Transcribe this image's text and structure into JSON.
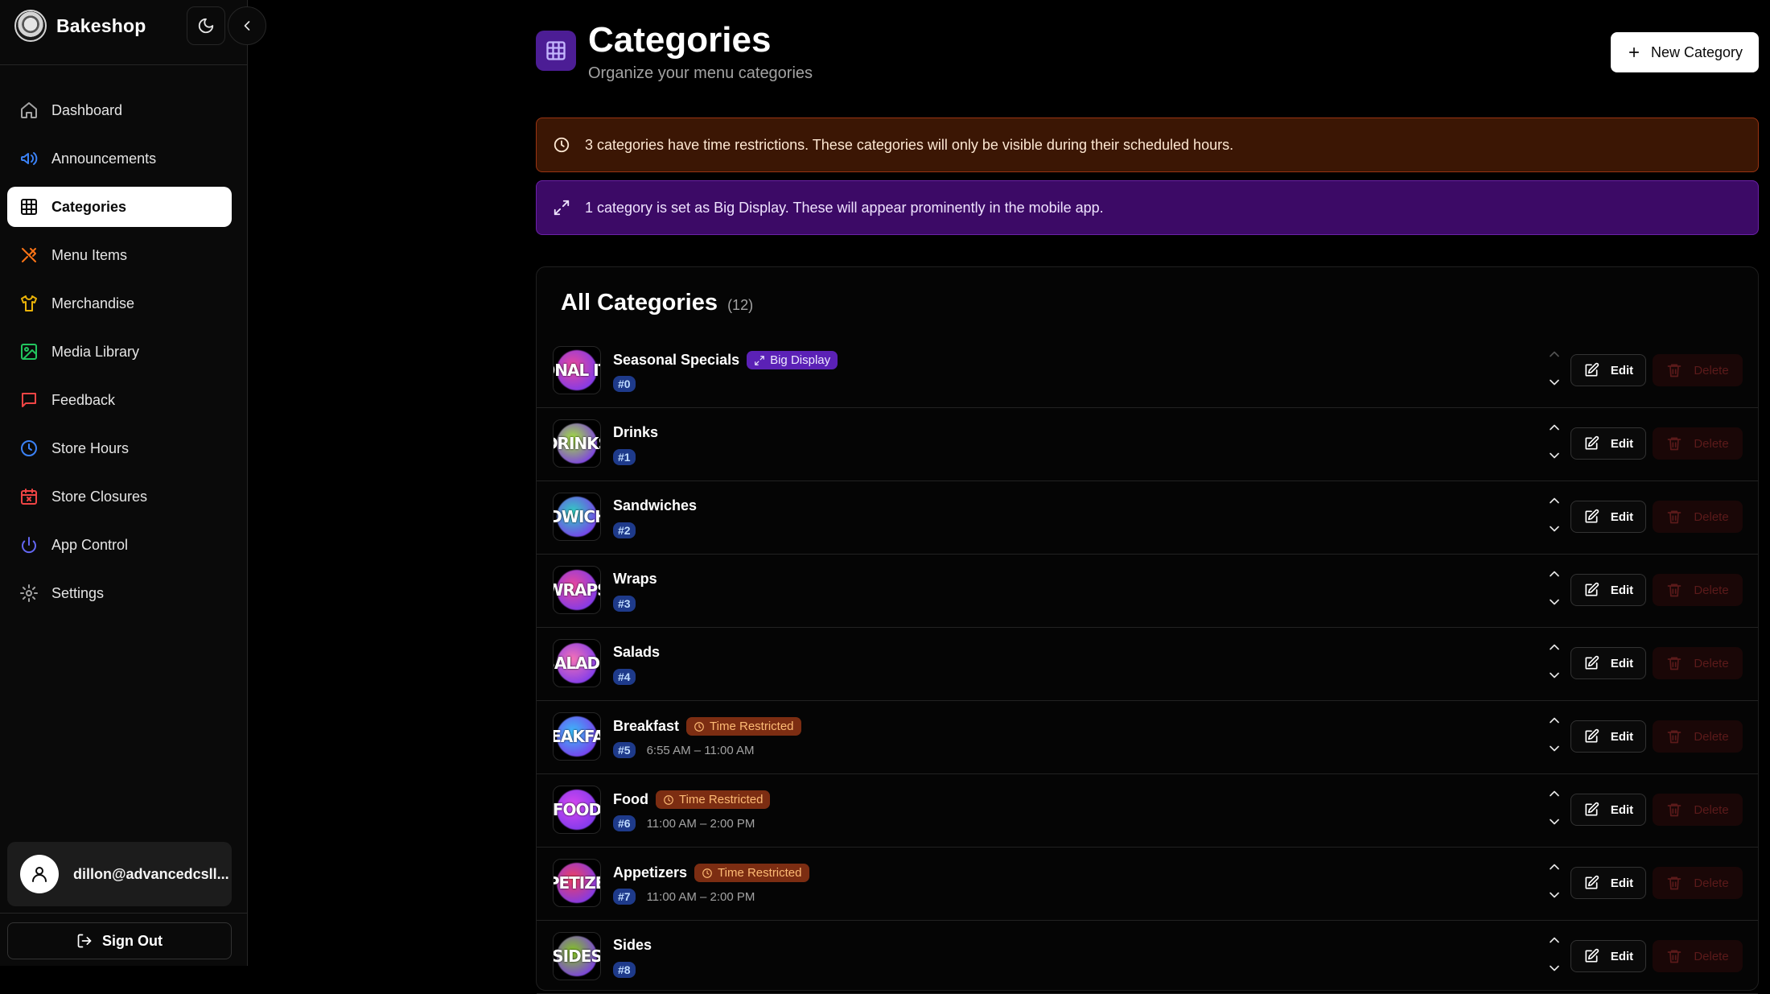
{
  "brand": {
    "name": "Bakeshop"
  },
  "sidebar": {
    "items": [
      {
        "label": "Dashboard",
        "icon": "home-icon",
        "color": "#a3a3a3"
      },
      {
        "label": "Announcements",
        "icon": "megaphone-icon",
        "color": "#3b82f6"
      },
      {
        "label": "Categories",
        "icon": "grid-icon",
        "color": "#0a0a0a",
        "active": true
      },
      {
        "label": "Menu Items",
        "icon": "utensils-icon",
        "color": "#f97316"
      },
      {
        "label": "Merchandise",
        "icon": "shirt-icon",
        "color": "#eab308"
      },
      {
        "label": "Media Library",
        "icon": "image-icon",
        "color": "#22c55e"
      },
      {
        "label": "Feedback",
        "icon": "message-icon",
        "color": "#ef4444"
      },
      {
        "label": "Store Hours",
        "icon": "clock-icon",
        "color": "#3b82f6"
      },
      {
        "label": "Store Closures",
        "icon": "calendar-x-icon",
        "color": "#ef4444"
      },
      {
        "label": "App Control",
        "icon": "power-icon",
        "color": "#6366f1"
      },
      {
        "label": "Settings",
        "icon": "gear-icon",
        "color": "#a3a3a3"
      }
    ],
    "user_email": "dillon@advancedcsll...",
    "sign_out": "Sign Out"
  },
  "header": {
    "title": "Categories",
    "subtitle": "Organize your menu categories",
    "new_button": "New Category"
  },
  "banners": {
    "time_restrictions": "3 categories have time restrictions. These categories will only be visible during their scheduled hours.",
    "big_display": "1 category is set as Big Display. These will appear prominently in the mobile app."
  },
  "list": {
    "title": "All Categories",
    "count": "(12)",
    "edit_label": "Edit",
    "delete_label": "Delete",
    "big_display_label": "Big Display",
    "time_restricted_label": "Time Restricted",
    "rows": [
      {
        "name": "Seasonal Specials",
        "position": "#0",
        "badge": "big",
        "hours": "",
        "thumb": "EASONAL ITEMS",
        "blob": "#ec4899"
      },
      {
        "name": "Drinks",
        "position": "#1",
        "badge": "",
        "hours": "",
        "thumb": "DRINKS",
        "blob": "#a3e635"
      },
      {
        "name": "Sandwiches",
        "position": "#2",
        "badge": "",
        "hours": "",
        "thumb": "NDWICHE",
        "blob": "#2dd4bf"
      },
      {
        "name": "Wraps",
        "position": "#3",
        "badge": "",
        "hours": "",
        "thumb": "WRAPS",
        "blob": "#ec4899"
      },
      {
        "name": "Salads",
        "position": "#4",
        "badge": "",
        "hours": "",
        "thumb": "SALADS",
        "blob": "#f472b6"
      },
      {
        "name": "Breakfast",
        "position": "#5",
        "badge": "time",
        "hours": "6:55 AM – 11:00 AM",
        "thumb": "REAKFAS",
        "blob": "#38bdf8"
      },
      {
        "name": "Food",
        "position": "#6",
        "badge": "time",
        "hours": "11:00 AM – 2:00 PM",
        "thumb": "FOOD",
        "blob": "#d946ef"
      },
      {
        "name": "Appetizers",
        "position": "#7",
        "badge": "time",
        "hours": "11:00 AM – 2:00 PM",
        "thumb": "PPETIZER",
        "blob": "#f43f5e"
      },
      {
        "name": "Sides",
        "position": "#8",
        "badge": "",
        "hours": "",
        "thumb": "SIDES",
        "blob": "#84cc16"
      }
    ]
  }
}
